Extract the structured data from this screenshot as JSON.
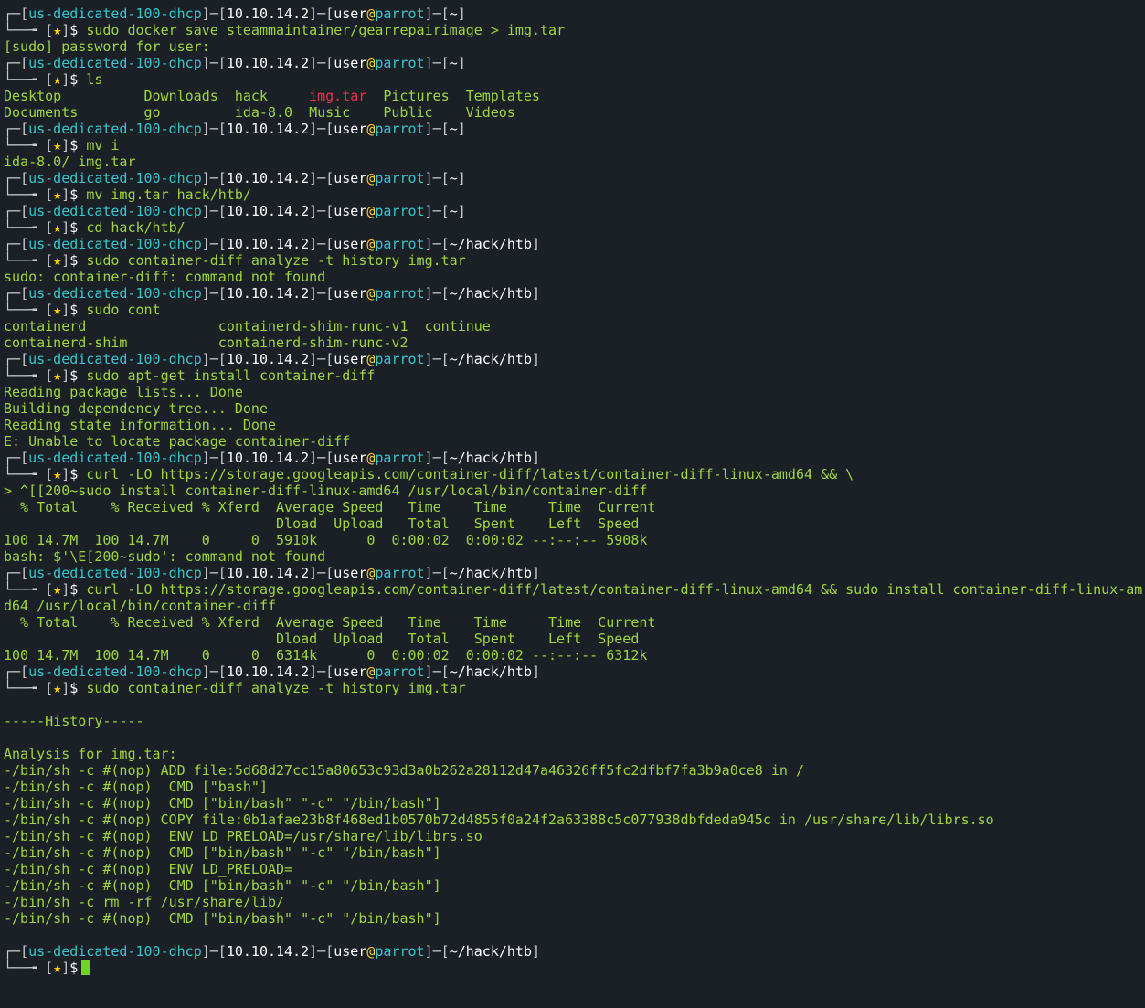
{
  "prompt": {
    "host": "us-dedicated-100-dhcp",
    "ip": "10.10.14.2",
    "user": "user",
    "at": "@",
    "machine": "parrot",
    "star": "★",
    "dollar": "$"
  },
  "colors": {
    "background": "#1a2026",
    "text": "#9fd63f",
    "host": "#34c5d0",
    "at": "#ffcc33",
    "star": "#ffd700",
    "highlight_file": "#e8304b",
    "cursor": "#6fd32a"
  },
  "lines": [
    {
      "type": "p1",
      "path": "~"
    },
    {
      "type": "p2",
      "cmd": "sudo docker save steammaintainer/gearrepairimage > img.tar"
    },
    {
      "type": "out",
      "text": "[sudo] password for user:"
    },
    {
      "type": "p1",
      "path": "~"
    },
    {
      "type": "p2",
      "cmd": "ls"
    },
    {
      "type": "ls",
      "items": [
        "Desktop",
        "Downloads",
        "hack",
        "img.tar",
        "Pictures",
        "Templates"
      ],
      "red": [
        3
      ]
    },
    {
      "type": "ls",
      "items": [
        "Documents",
        "go",
        "ida-8.0",
        "Music",
        "Public",
        "Videos"
      ],
      "red": []
    },
    {
      "type": "p1",
      "path": "~"
    },
    {
      "type": "p2",
      "cmd": "mv i"
    },
    {
      "type": "out",
      "text": "ida-8.0/ img.tar"
    },
    {
      "type": "p1",
      "path": "~"
    },
    {
      "type": "p2",
      "cmd": "mv img.tar hack/htb/"
    },
    {
      "type": "p1",
      "path": "~"
    },
    {
      "type": "p2",
      "cmd": "cd hack/htb/"
    },
    {
      "type": "p1",
      "path": "~/hack/htb"
    },
    {
      "type": "p2",
      "cmd": "sudo container-diff analyze -t history img.tar"
    },
    {
      "type": "out",
      "text": "sudo: container-diff: command not found"
    },
    {
      "type": "p1",
      "path": "~/hack/htb"
    },
    {
      "type": "p2",
      "cmd": "sudo cont"
    },
    {
      "type": "out",
      "text": "containerd                containerd-shim-runc-v1  continue"
    },
    {
      "type": "out",
      "text": "containerd-shim           containerd-shim-runc-v2"
    },
    {
      "type": "p1",
      "path": "~/hack/htb"
    },
    {
      "type": "p2",
      "cmd": "sudo apt-get install container-diff"
    },
    {
      "type": "out",
      "text": "Reading package lists... Done"
    },
    {
      "type": "out",
      "text": "Building dependency tree... Done"
    },
    {
      "type": "out",
      "text": "Reading state information... Done"
    },
    {
      "type": "out",
      "text": "E: Unable to locate package container-diff"
    },
    {
      "type": "p1",
      "path": "~/hack/htb"
    },
    {
      "type": "p2",
      "cmd": "curl -LO https://storage.googleapis.com/container-diff/latest/container-diff-linux-amd64 && \\"
    },
    {
      "type": "out",
      "text": "> ^[[200~sudo install container-diff-linux-amd64 /usr/local/bin/container-diff"
    },
    {
      "type": "out",
      "text": "  % Total    % Received % Xferd  Average Speed   Time    Time     Time  Current"
    },
    {
      "type": "out",
      "text": "                                 Dload  Upload   Total   Spent    Left  Speed"
    },
    {
      "type": "out",
      "text": "100 14.7M  100 14.7M    0     0  5910k      0  0:00:02  0:00:02 --:--:-- 5908k"
    },
    {
      "type": "out",
      "text": "bash: $'\\E[200~sudo': command not found"
    },
    {
      "type": "p1",
      "path": "~/hack/htb"
    },
    {
      "type": "p2",
      "cmd": "curl -LO https://storage.googleapis.com/container-diff/latest/container-diff-linux-amd64 && sudo install container-diff-linux-am"
    },
    {
      "type": "out",
      "text": "d64 /usr/local/bin/container-diff"
    },
    {
      "type": "out",
      "text": "  % Total    % Received % Xferd  Average Speed   Time    Time     Time  Current"
    },
    {
      "type": "out",
      "text": "                                 Dload  Upload   Total   Spent    Left  Speed"
    },
    {
      "type": "out",
      "text": "100 14.7M  100 14.7M    0     0  6314k      0  0:00:02  0:00:02 --:--:-- 6312k"
    },
    {
      "type": "p1",
      "path": "~/hack/htb"
    },
    {
      "type": "p2",
      "cmd": "sudo container-diff analyze -t history img.tar"
    },
    {
      "type": "out",
      "text": ""
    },
    {
      "type": "out",
      "text": "-----History-----"
    },
    {
      "type": "out",
      "text": ""
    },
    {
      "type": "out",
      "text": "Analysis for img.tar:"
    },
    {
      "type": "out",
      "text": "-/bin/sh -c #(nop) ADD file:5d68d27cc15a80653c93d3a0b262a28112d47a46326ff5fc2dfbf7fa3b9a0ce8 in / "
    },
    {
      "type": "out",
      "text": "-/bin/sh -c #(nop)  CMD [\"bash\"]"
    },
    {
      "type": "out",
      "text": "-/bin/sh -c #(nop)  CMD [\"bin/bash\" \"-c\" \"/bin/bash\"]"
    },
    {
      "type": "out",
      "text": "-/bin/sh -c #(nop) COPY file:0b1afae23b8f468ed1b0570b72d4855f0a24f2a63388c5c077938dbfdeda945c in /usr/share/lib/librs.so "
    },
    {
      "type": "out",
      "text": "-/bin/sh -c #(nop)  ENV LD_PRELOAD=/usr/share/lib/librs.so"
    },
    {
      "type": "out",
      "text": "-/bin/sh -c #(nop)  CMD [\"bin/bash\" \"-c\" \"/bin/bash\"]"
    },
    {
      "type": "out",
      "text": "-/bin/sh -c #(nop)  ENV LD_PRELOAD="
    },
    {
      "type": "out",
      "text": "-/bin/sh -c #(nop)  CMD [\"bin/bash\" \"-c\" \"/bin/bash\"]"
    },
    {
      "type": "out",
      "text": "-/bin/sh -c rm -rf /usr/share/lib/"
    },
    {
      "type": "out",
      "text": "-/bin/sh -c #(nop)  CMD [\"bin/bash\" \"-c\" \"/bin/bash\"]"
    },
    {
      "type": "out",
      "text": ""
    },
    {
      "type": "p1",
      "path": "~/hack/htb"
    },
    {
      "type": "p2",
      "cmd": "",
      "cursor": true
    }
  ]
}
